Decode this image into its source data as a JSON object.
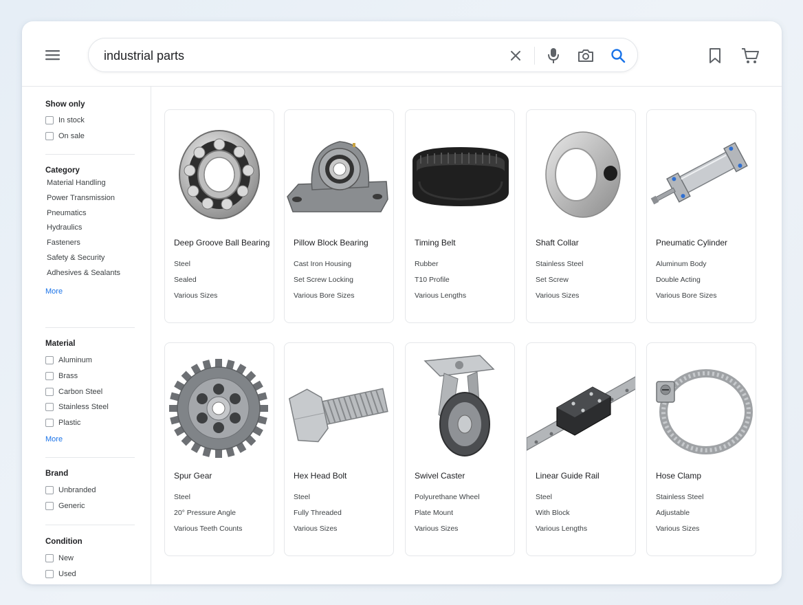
{
  "search": {
    "query": "industrial parts"
  },
  "icons": {
    "menu": "menu-icon",
    "clear": "close-icon",
    "mic": "microphone-icon",
    "camera": "camera-icon",
    "search": "search-icon",
    "bookmark": "bookmark-icon",
    "cart": "cart-icon"
  },
  "colors": {
    "accent": "#1a73e8",
    "text": "#202124",
    "border": "#e5e7ea"
  },
  "sidebar": {
    "show_only": {
      "title": "Show only",
      "options": [
        "In stock",
        "On sale"
      ]
    },
    "category": {
      "title": "Category",
      "items": [
        "Material Handling",
        "Power Transmission",
        "Pneumatics",
        "Hydraulics",
        "Fasteners",
        "Safety & Security",
        "Adhesives & Sealants"
      ],
      "more": "More"
    },
    "material": {
      "title": "Material",
      "options": [
        "Aluminum",
        "Brass",
        "Carbon Steel",
        "Stainless Steel",
        "Plastic"
      ],
      "more": "More"
    },
    "brand": {
      "title": "Brand",
      "options": [
        "Unbranded",
        "Generic"
      ]
    },
    "condition": {
      "title": "Condition",
      "options": [
        "New",
        "Used"
      ]
    }
  },
  "products": [
    {
      "title": "Deep Groove Ball Bearing",
      "specs": [
        "Steel",
        "Sealed",
        "Various Sizes"
      ],
      "image": "ball-bearing"
    },
    {
      "title": "Pillow Block Bearing",
      "specs": [
        "Cast Iron Housing",
        "Set Screw Locking",
        "Various Bore Sizes"
      ],
      "image": "pillow-block"
    },
    {
      "title": "Timing Belt",
      "specs": [
        "Rubber",
        "T10 Profile",
        "Various Lengths"
      ],
      "image": "timing-belt"
    },
    {
      "title": "Shaft Collar",
      "specs": [
        "Stainless Steel",
        "Set Screw",
        "Various Sizes"
      ],
      "image": "shaft-collar"
    },
    {
      "title": "Pneumatic Cylinder",
      "specs": [
        "Aluminum Body",
        "Double Acting",
        "Various Bore Sizes"
      ],
      "image": "pneumatic-cylinder"
    },
    {
      "title": "Spur Gear",
      "specs": [
        "Steel",
        "20° Pressure Angle",
        "Various Teeth Counts"
      ],
      "image": "spur-gear"
    },
    {
      "title": "Hex Head Bolt",
      "specs": [
        "Steel",
        "Fully Threaded",
        "Various Sizes"
      ],
      "image": "hex-bolt"
    },
    {
      "title": "Swivel Caster",
      "specs": [
        "Polyurethane Wheel",
        "Plate Mount",
        "Various Sizes"
      ],
      "image": "swivel-caster"
    },
    {
      "title": "Linear Guide Rail",
      "specs": [
        "Steel",
        "With Block",
        "Various Lengths"
      ],
      "image": "linear-guide"
    },
    {
      "title": "Hose Clamp",
      "specs": [
        "Stainless Steel",
        "Adjustable",
        "Various Sizes"
      ],
      "image": "hose-clamp"
    }
  ]
}
